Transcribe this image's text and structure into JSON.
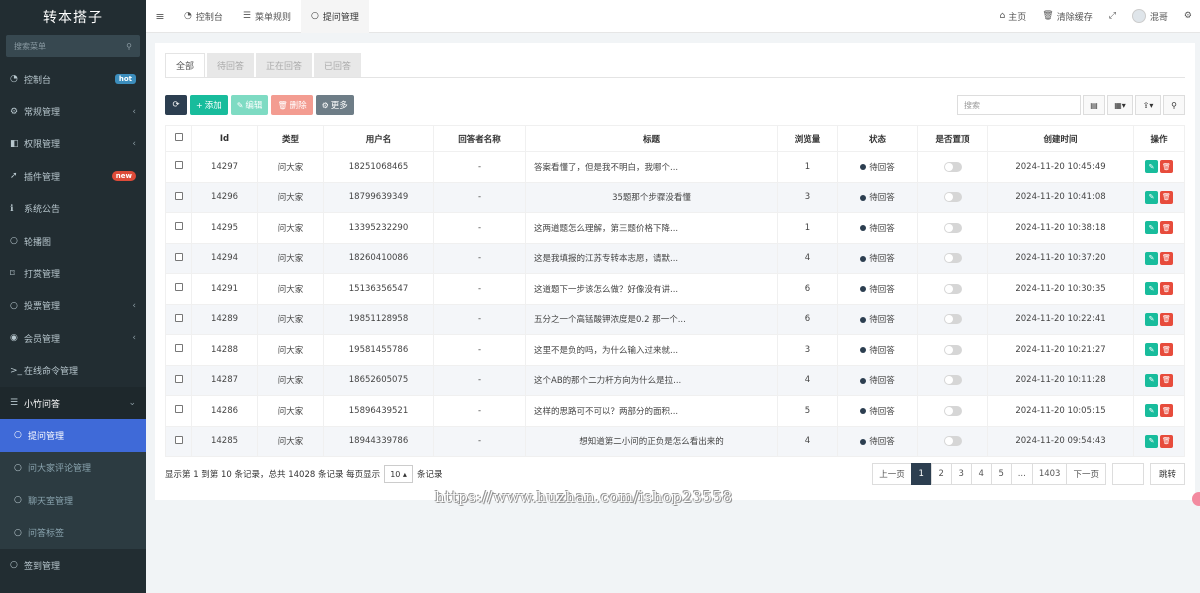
{
  "sidebar": {
    "brand": "转本搭子",
    "search_placeholder": "搜索菜单",
    "items": [
      {
        "label": "控制台",
        "icon": "dashboard-icon",
        "glyph": "◔",
        "badge": "hot"
      },
      {
        "label": "常规管理",
        "icon": "cogs-icon",
        "glyph": "⚙",
        "arrow": "‹"
      },
      {
        "label": "权限管理",
        "icon": "group-icon",
        "glyph": "◧",
        "arrow": "‹"
      },
      {
        "label": "插件管理",
        "icon": "rocket-icon",
        "glyph": "➚",
        "badge": "new"
      },
      {
        "label": "系统公告",
        "icon": "info-icon",
        "glyph": "ℹ"
      },
      {
        "label": "轮播图",
        "icon": "circle-icon",
        "glyph": "○"
      },
      {
        "label": "打赏管理",
        "icon": "bookmark-icon",
        "glyph": "⌑"
      },
      {
        "label": "投票管理",
        "icon": "circle-icon",
        "glyph": "○",
        "arrow": "‹"
      },
      {
        "label": "会员管理",
        "icon": "user-circle-icon",
        "glyph": "◉",
        "arrow": "‹"
      },
      {
        "label": "在线命令管理",
        "icon": "terminal-icon",
        "glyph": ">_"
      }
    ],
    "open_group": {
      "label": "小竹问答",
      "icon": "list-icon",
      "glyph": "☰",
      "arrow": "⌄"
    },
    "sub_items": [
      {
        "label": "提问管理",
        "active": true
      },
      {
        "label": "问大家评论管理"
      },
      {
        "label": "聊天室管理"
      },
      {
        "label": "问答标签"
      }
    ],
    "after_group": [
      {
        "label": "签到管理",
        "icon": "circle-icon",
        "glyph": "○"
      }
    ]
  },
  "topbar": {
    "toggle": "≡",
    "tabs": [
      {
        "label": "控制台",
        "glyph": "◔"
      },
      {
        "label": "菜单规则",
        "glyph": "☰"
      },
      {
        "label": "提问管理",
        "glyph": "○",
        "active": true
      }
    ],
    "home": "主页",
    "clear_cache": "清除缓存",
    "fullscreen_glyph": "⤢",
    "username": "混哥",
    "settings_glyph": "⚙"
  },
  "panel": {
    "tabs": [
      "全部",
      "待回答",
      "正在回答",
      "已回答"
    ],
    "toolbar": {
      "add": "添加",
      "edit": "编辑",
      "delete": "删除",
      "more": "更多",
      "search_placeholder": "搜索"
    },
    "columns": [
      "Id",
      "类型",
      "用户名",
      "回答者名称",
      "标题",
      "浏览量",
      "状态",
      "是否置顶",
      "创建时间",
      "操作"
    ],
    "rows": [
      {
        "id": "14297",
        "type": "问大家",
        "user": "18251068465",
        "answerer": "-",
        "title": "答案看懂了，但是我不明白，我哪个...",
        "views": "1",
        "status": "待回答",
        "created": "2024-11-20 10:45:49"
      },
      {
        "id": "14296",
        "type": "问大家",
        "user": "18799639349",
        "answerer": "-",
        "title": "35题那个步骤没看懂",
        "views": "3",
        "status": "待回答",
        "created": "2024-11-20 10:41:08"
      },
      {
        "id": "14295",
        "type": "问大家",
        "user": "13395232290",
        "answerer": "-",
        "title": "这两道题怎么理解，第三题价格下降...",
        "views": "1",
        "status": "待回答",
        "created": "2024-11-20 10:38:18"
      },
      {
        "id": "14294",
        "type": "问大家",
        "user": "18260410086",
        "answerer": "-",
        "title": "这是我填报的江苏专转本志愿，请默...",
        "views": "4",
        "status": "待回答",
        "created": "2024-11-20 10:37:20"
      },
      {
        "id": "14291",
        "type": "问大家",
        "user": "15136356547",
        "answerer": "-",
        "title": "这道题下一步该怎么做？好像没有讲...",
        "views": "6",
        "status": "待回答",
        "created": "2024-11-20 10:30:35"
      },
      {
        "id": "14289",
        "type": "问大家",
        "user": "19851128958",
        "answerer": "-",
        "title": "五分之一个高锰酸钾浓度是0.2 那一个...",
        "views": "6",
        "status": "待回答",
        "created": "2024-11-20 10:22:41"
      },
      {
        "id": "14288",
        "type": "问大家",
        "user": "19581455786",
        "answerer": "-",
        "title": "这里不是负的吗，为什么输入过来就...",
        "views": "3",
        "status": "待回答",
        "created": "2024-11-20 10:21:27"
      },
      {
        "id": "14287",
        "type": "问大家",
        "user": "18652605075",
        "answerer": "-",
        "title": "这个AB的那个二力杆方向为什么是拉...",
        "views": "4",
        "status": "待回答",
        "created": "2024-11-20 10:11:28"
      },
      {
        "id": "14286",
        "type": "问大家",
        "user": "15896439521",
        "answerer": "-",
        "title": "这样的思路可不可以？两部分的面积...",
        "views": "5",
        "status": "待回答",
        "created": "2024-11-20 10:05:15"
      },
      {
        "id": "14285",
        "type": "问大家",
        "user": "18944339786",
        "answerer": "-",
        "title": "想知道第二小问的正负是怎么看出来的",
        "views": "4",
        "status": "待回答",
        "created": "2024-11-20 09:54:43"
      }
    ],
    "footer": {
      "info_prefix": "显示第 1 到第 10 条记录，总共 14028 条记录 每页显示",
      "page_size": "10",
      "info_suffix": "条记录"
    },
    "pager": {
      "prev": "上一页",
      "pages": [
        "1",
        "2",
        "3",
        "4",
        "5",
        "...",
        "1403"
      ],
      "next": "下一页",
      "jump": "跳转"
    }
  },
  "watermark": "https://www.huzhan.com/ishop23558"
}
